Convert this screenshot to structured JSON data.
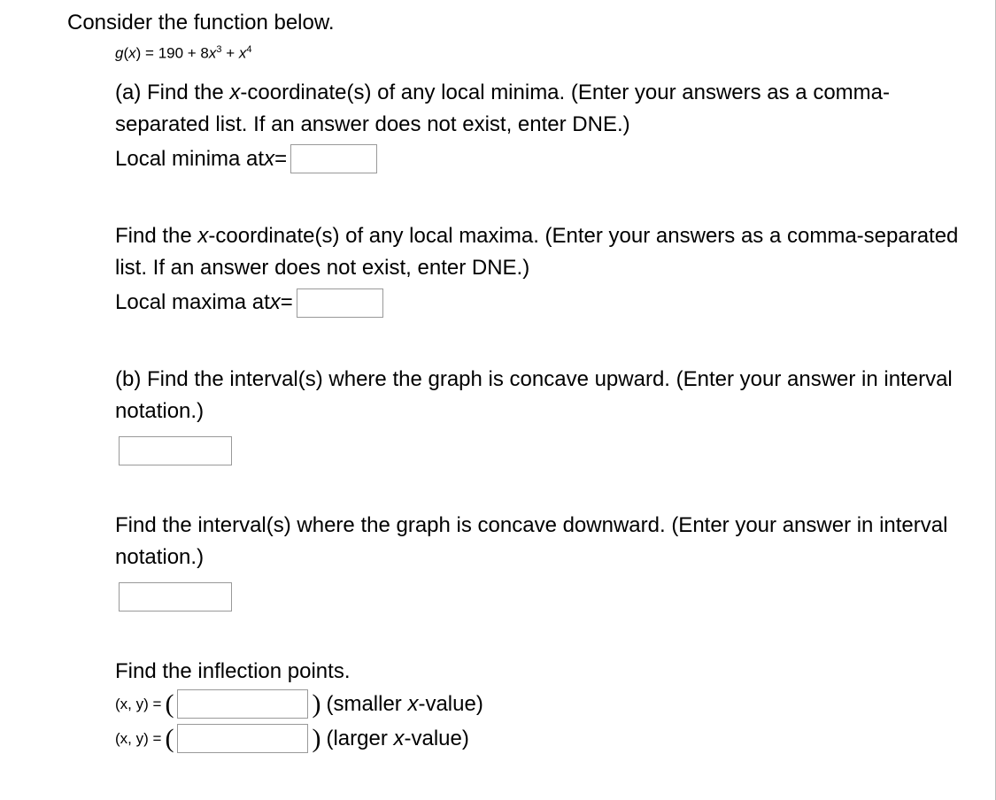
{
  "intro": "Consider the function below.",
  "function": {
    "lhs_var": "g",
    "lhs_arg": "x",
    "eq": " = ",
    "term1": "190 + 8",
    "term2_var": "x",
    "term2_exp": "3",
    "plus": " + ",
    "term3_var": "x",
    "term3_exp": "4"
  },
  "partA": {
    "minima_text1": "(a) Find the ",
    "minima_var": "x",
    "minima_text2": "-coordinate(s) of any local minima. (Enter your answers as a comma-separated list. If an answer does not exist, enter DNE.)",
    "minima_label1": "Local minima at ",
    "minima_label_var": "x",
    "minima_label2": " = ",
    "maxima_text1": "Find the ",
    "maxima_var": "x",
    "maxima_text2": "-coordinate(s) of any local maxima. (Enter your answers as a comma-separated list. If an answer does not exist, enter DNE.)",
    "maxima_label1": "Local maxima at ",
    "maxima_label_var": "x",
    "maxima_label2": " = "
  },
  "partB": {
    "concave_up": "(b) Find the interval(s) where the graph is concave upward. (Enter your answer in interval notation.)",
    "concave_down": "Find the interval(s) where the graph is concave downward. (Enter your answer in interval notation.)",
    "inflection_heading": "Find the inflection points.",
    "xy1_open": "(",
    "xy1_x": "x",
    "xy1_comma": ", ",
    "xy1_y": "y",
    "xy1_close": ")",
    "xy1_eq": " = ",
    "paren_open": "(",
    "paren_close": ")",
    "smaller_note1": "(smaller ",
    "smaller_var": "x",
    "smaller_note2": "-value)",
    "larger_note1": "(larger ",
    "larger_var": "x",
    "larger_note2": "-value)"
  }
}
